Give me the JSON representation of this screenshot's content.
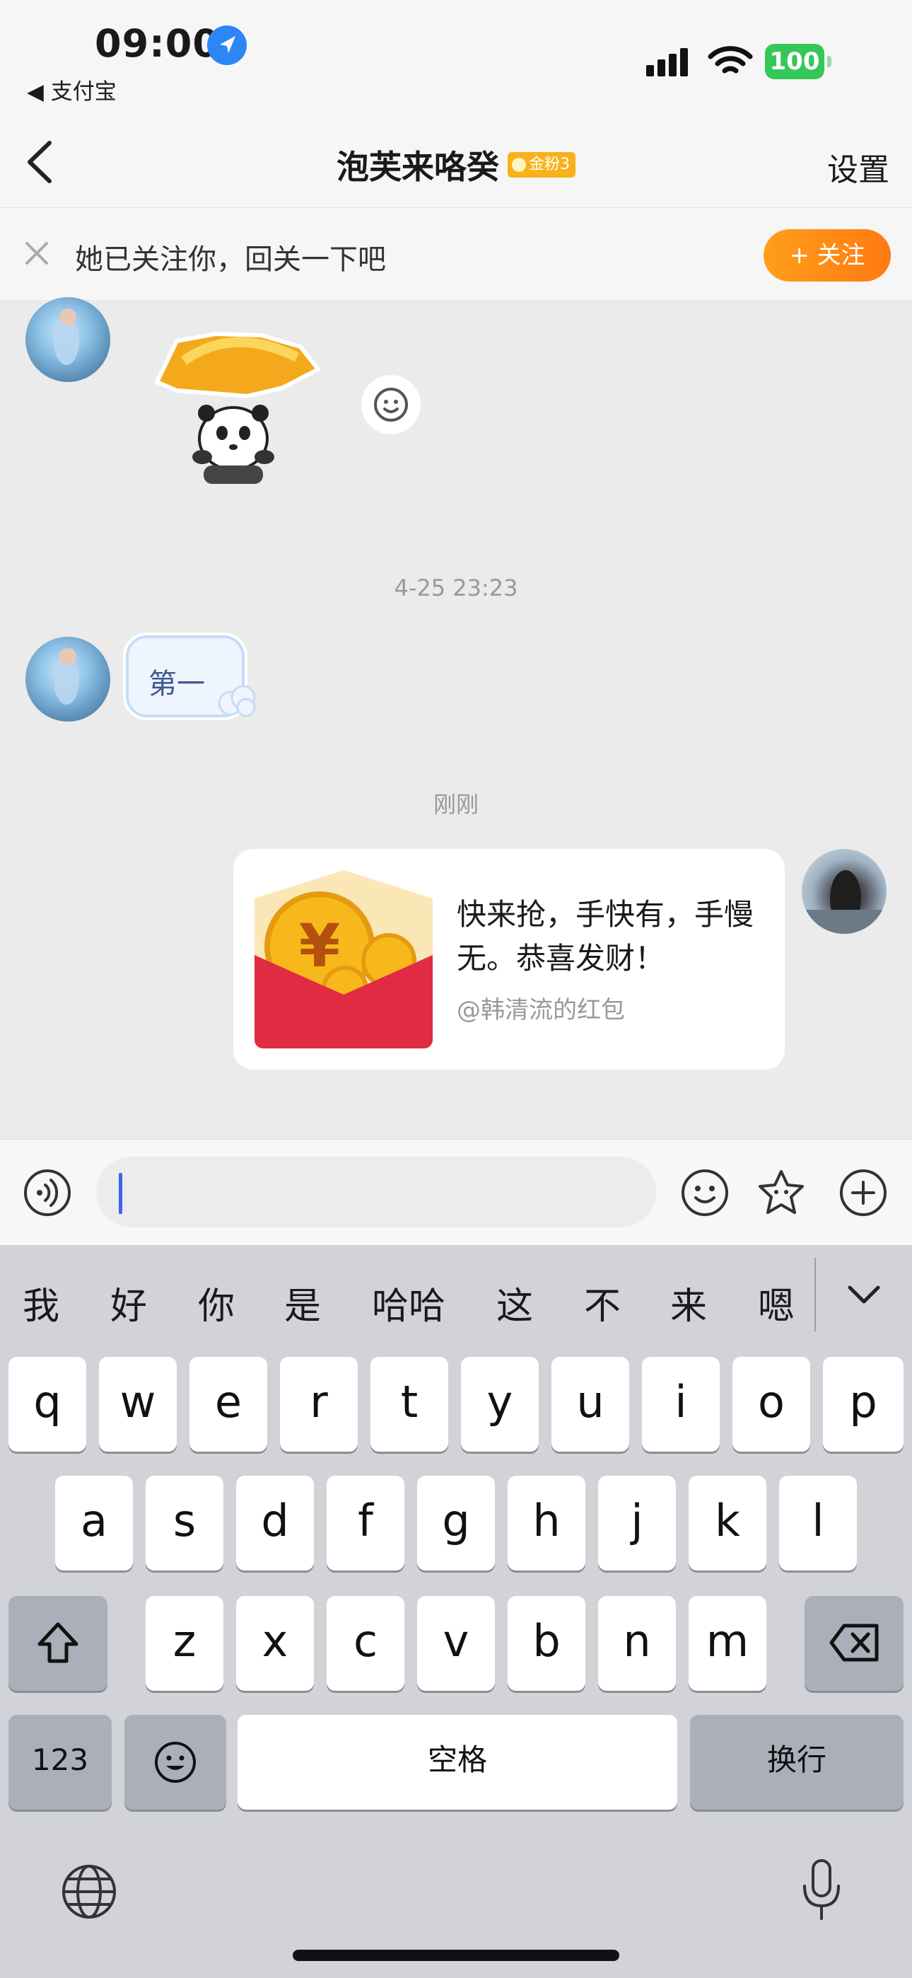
{
  "status_bar": {
    "time": "09:00",
    "back_app": "◀ 支付宝",
    "battery": "100"
  },
  "nav": {
    "title": "泡芙来咯癸",
    "badge": "金粉3",
    "settings": "设置"
  },
  "follow_bar": {
    "text": "她已关注你，回关一下吧",
    "button": "+ 关注"
  },
  "messages": {
    "timestamp_1": "4-25 23:23",
    "bubble_1": "第一",
    "timestamp_2": "刚刚",
    "redpacket": {
      "text": "快来抢，手快有，手慢无。恭喜发财！",
      "source": "@韩清流的红包"
    }
  },
  "input": {
    "value": ""
  },
  "keyboard": {
    "candidates": [
      "我",
      "好",
      "你",
      "是",
      "哈哈",
      "这",
      "不",
      "来",
      "嗯"
    ],
    "row1": [
      "q",
      "w",
      "e",
      "r",
      "t",
      "y",
      "u",
      "i",
      "o",
      "p"
    ],
    "row2": [
      "a",
      "s",
      "d",
      "f",
      "g",
      "h",
      "j",
      "k",
      "l"
    ],
    "row3": [
      "z",
      "x",
      "c",
      "v",
      "b",
      "n",
      "m"
    ],
    "numbers_label": "123",
    "space_label": "空格",
    "return_label": "换行"
  },
  "colors": {
    "accent_orange": "#ff8a17",
    "badge_gold": "#f7b21b",
    "battery_green": "#35c759",
    "location_blue": "#2d86f5",
    "redpacket_red": "#e02b43",
    "caret_blue": "#3a63f0"
  },
  "icons": {
    "location": "location-arrow-icon",
    "signal": "cellular-signal-icon",
    "wifi": "wifi-icon",
    "back": "chevron-left-icon",
    "close": "close-icon",
    "voice": "voice-icon",
    "emoji": "emoji-icon",
    "sticker": "sticker-icon",
    "plus": "plus-icon",
    "globe": "globe-icon",
    "microphone": "microphone-icon"
  }
}
